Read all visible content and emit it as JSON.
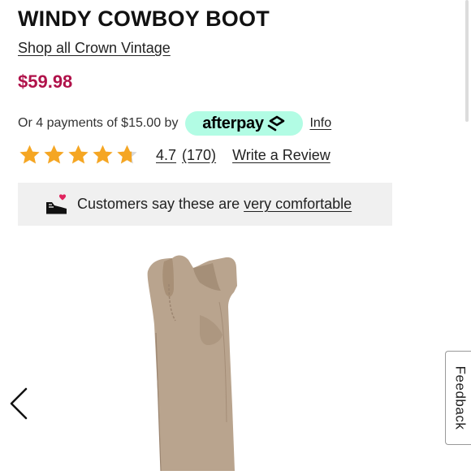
{
  "product": {
    "title": "WINDY COWBOY BOOT",
    "brand_link": "Shop all Crown Vintage",
    "price": "$59.98"
  },
  "payments": {
    "text": "Or 4 payments of $15.00 by",
    "provider": "afterpay",
    "info_link": "Info"
  },
  "rating": {
    "stars_value": 4.7,
    "stars_max": 5,
    "value_text": "4.7",
    "count_text": "(170)",
    "write_review": "Write a Review"
  },
  "comfort": {
    "text": "Customers say these are",
    "link": "very comfortable",
    "icon": "sneaker-heart-icon"
  },
  "gallery": {
    "prev_icon": "chevron-left-icon"
  },
  "feedback": {
    "label": "Feedback"
  },
  "colors": {
    "price": "#b0124a",
    "afterpay_bg": "#b2fce4",
    "star": "#f5a623",
    "star_empty": "#d8d8d8",
    "heart": "#e0245e",
    "comfort_bg": "#f0f0f0",
    "boot": "#b9a48e"
  }
}
